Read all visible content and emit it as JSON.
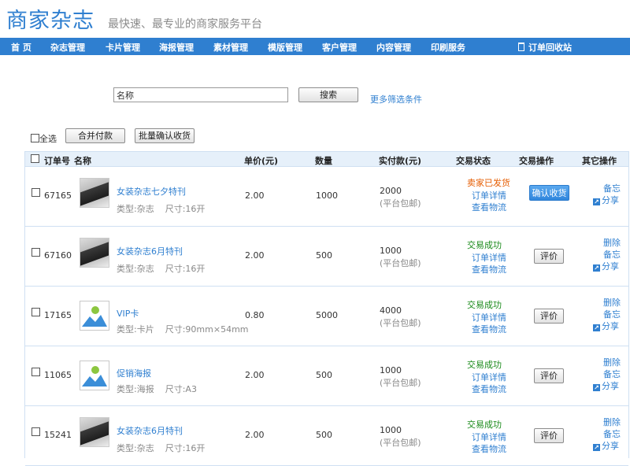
{
  "header": {
    "logo": "商家杂志",
    "slogan": "最快速、最专业的商家服务平台"
  },
  "nav": {
    "items": [
      "首 页",
      "杂志管理",
      "卡片管理",
      "海报管理",
      "素材管理",
      "模版管理",
      "客户管理",
      "内容管理",
      "印刷服务"
    ],
    "trash": "订单回收站"
  },
  "search": {
    "value": "名称",
    "button": "搜索",
    "more": "更多筛选条件"
  },
  "toolbar": {
    "select_all": "全选",
    "merge_pay": "合并付款",
    "batch_confirm": "批量确认收货"
  },
  "table": {
    "headers": [
      "订单号",
      "名称",
      "单价(元)",
      "数量",
      "实付款(元)",
      "交易状态",
      "交易操作",
      "其它操作"
    ],
    "rows": [
      {
        "id": "67165",
        "name": "女装杂志七夕特刊",
        "type": "类型:杂志",
        "size": "尺寸:16开",
        "thumb": "photo",
        "price": "2.00",
        "qty": "1000",
        "paid": "2000",
        "paid_note": "(平台包邮)",
        "status": "卖家已发货",
        "status_color": "#e65c00",
        "detail": "订单详情",
        "logistics": "查看物流",
        "action": "确认收货",
        "action_style": "primary",
        "others": [
          "备忘",
          "分享"
        ]
      },
      {
        "id": "67160",
        "name": "女装杂志6月特刊",
        "type": "类型:杂志",
        "size": "尺寸:16开",
        "thumb": "photo",
        "price": "2.00",
        "qty": "500",
        "paid": "1000",
        "paid_note": "(平台包邮)",
        "status": "交易成功",
        "status_color": "#1a8a1a",
        "detail": "订单详情",
        "logistics": "查看物流",
        "action": "评价",
        "action_style": "default",
        "others": [
          "删除",
          "备忘",
          "分享"
        ]
      },
      {
        "id": "17165",
        "name": "VIP卡",
        "type": "类型:卡片",
        "size": "尺寸:90mm×54mm",
        "thumb": "placeholder",
        "price": "0.80",
        "qty": "5000",
        "paid": "4000",
        "paid_note": "(平台包邮)",
        "status": "交易成功",
        "status_color": "#1a8a1a",
        "detail": "订单详情",
        "logistics": "查看物流",
        "action": "评价",
        "action_style": "default",
        "others": [
          "删除",
          "备忘",
          "分享"
        ]
      },
      {
        "id": "11065",
        "name": "促销海报",
        "type": "类型:海报",
        "size": "尺寸:A3",
        "thumb": "placeholder",
        "price": "2.00",
        "qty": "500",
        "paid": "1000",
        "paid_note": "(平台包邮)",
        "status": "交易成功",
        "status_color": "#1a8a1a",
        "detail": "订单详情",
        "logistics": "查看物流",
        "action": "评价",
        "action_style": "default",
        "others": [
          "删除",
          "备忘",
          "分享"
        ]
      },
      {
        "id": "15241",
        "name": "女装杂志6月特刊",
        "type": "类型:杂志",
        "size": "尺寸:16开",
        "thumb": "photo",
        "price": "2.00",
        "qty": "500",
        "paid": "1000",
        "paid_note": "(平台包邮)",
        "status": "交易成功",
        "status_color": "#1a8a1a",
        "detail": "订单详情",
        "logistics": "查看物流",
        "action": "评价",
        "action_style": "default",
        "others": [
          "删除",
          "备忘",
          "分享"
        ]
      }
    ]
  }
}
